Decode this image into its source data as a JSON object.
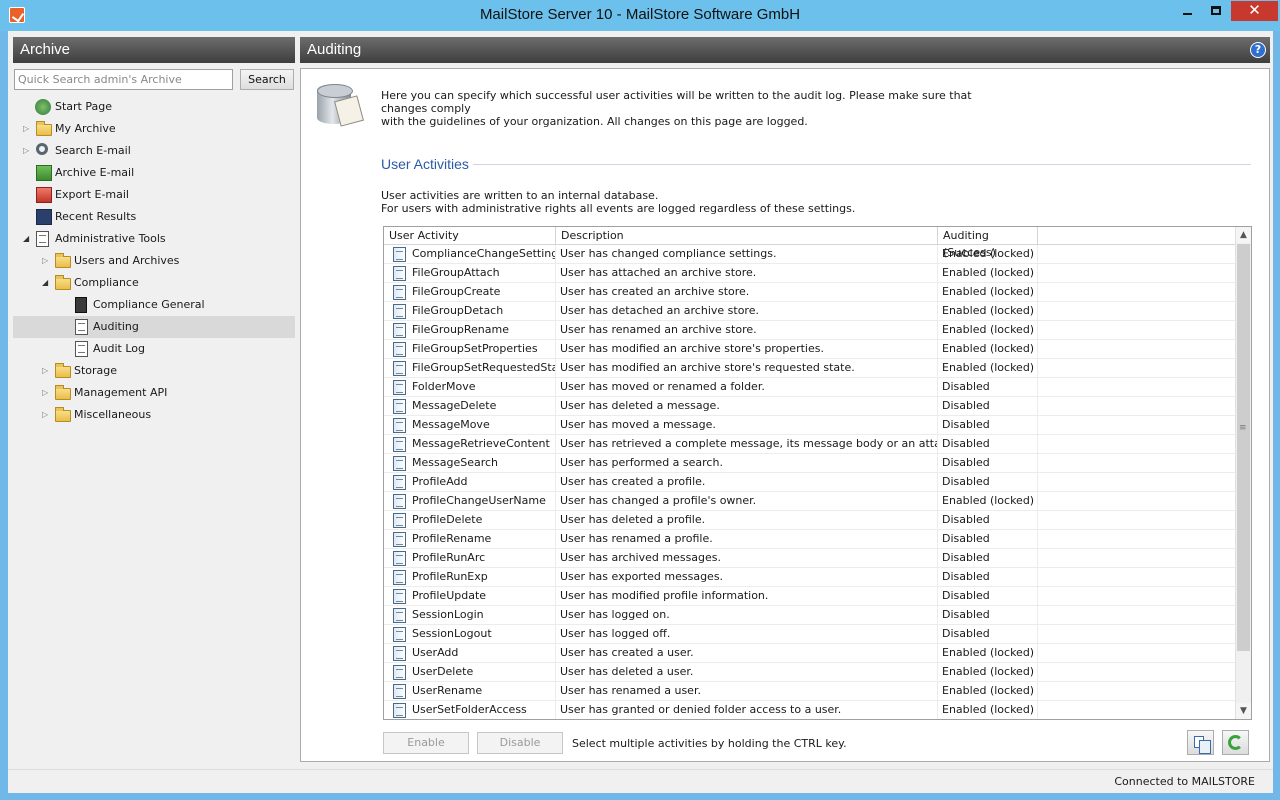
{
  "window": {
    "title": "MailStore Server 10 - MailStore Software GmbH",
    "minimize": "—",
    "close": "✕"
  },
  "sidebar": {
    "title": "Archive",
    "search_placeholder": "Quick Search admin's Archive",
    "search_button": "Search",
    "items": [
      {
        "label": "Start Page"
      },
      {
        "label": "My Archive"
      },
      {
        "label": "Search E-mail"
      },
      {
        "label": "Archive E-mail"
      },
      {
        "label": "Export E-mail"
      },
      {
        "label": "Recent Results"
      },
      {
        "label": "Administrative Tools"
      },
      {
        "label": "Users and Archives"
      },
      {
        "label": "Compliance"
      },
      {
        "label": "Compliance General"
      },
      {
        "label": "Auditing"
      },
      {
        "label": "Audit Log"
      },
      {
        "label": "Storage"
      },
      {
        "label": "Management API"
      },
      {
        "label": "Miscellaneous"
      }
    ]
  },
  "main": {
    "title": "Auditing",
    "help": "?",
    "intro_line1": "Here you can specify which successful user activities will be written to the audit log. Please make sure that changes comply",
    "intro_line2": "with the guidelines of your organization. All changes on this page are logged.",
    "section_title": "User Activities",
    "note_line1": "User activities are written to an internal database.",
    "note_line2": "For users with administrative rights all events are logged regardless of these settings.",
    "columns": [
      "User Activity",
      "Description",
      "Auditing (Success)"
    ],
    "rows": [
      {
        "activity": "ComplianceChangeSettings",
        "description": "User has changed compliance settings.",
        "auditing": "Enabled (locked)"
      },
      {
        "activity": "FileGroupAttach",
        "description": "User has attached an archive store.",
        "auditing": "Enabled (locked)"
      },
      {
        "activity": "FileGroupCreate",
        "description": "User has created an archive store.",
        "auditing": "Enabled (locked)"
      },
      {
        "activity": "FileGroupDetach",
        "description": "User has detached an archive store.",
        "auditing": "Enabled (locked)"
      },
      {
        "activity": "FileGroupRename",
        "description": "User has renamed an archive store.",
        "auditing": "Enabled (locked)"
      },
      {
        "activity": "FileGroupSetProperties",
        "description": "User has modified an archive store's properties.",
        "auditing": "Enabled (locked)"
      },
      {
        "activity": "FileGroupSetRequestedState",
        "description": "User has modified an archive store's requested state.",
        "auditing": "Enabled (locked)"
      },
      {
        "activity": "FolderMove",
        "description": "User has moved or renamed a folder.",
        "auditing": "Disabled"
      },
      {
        "activity": "MessageDelete",
        "description": "User has deleted a message.",
        "auditing": "Disabled"
      },
      {
        "activity": "MessageMove",
        "description": "User has moved a message.",
        "auditing": "Disabled"
      },
      {
        "activity": "MessageRetrieveContent",
        "description": "User has retrieved a complete message, its message body or an attachment.",
        "auditing": "Disabled"
      },
      {
        "activity": "MessageSearch",
        "description": "User has performed a search.",
        "auditing": "Disabled"
      },
      {
        "activity": "ProfileAdd",
        "description": "User has created a profile.",
        "auditing": "Disabled"
      },
      {
        "activity": "ProfileChangeUserName",
        "description": "User has changed a profile's owner.",
        "auditing": "Enabled (locked)"
      },
      {
        "activity": "ProfileDelete",
        "description": "User has deleted a profile.",
        "auditing": "Disabled"
      },
      {
        "activity": "ProfileRename",
        "description": "User has renamed a profile.",
        "auditing": "Disabled"
      },
      {
        "activity": "ProfileRunArc",
        "description": "User has archived messages.",
        "auditing": "Disabled"
      },
      {
        "activity": "ProfileRunExp",
        "description": "User has exported messages.",
        "auditing": "Disabled"
      },
      {
        "activity": "ProfileUpdate",
        "description": "User has modified profile information.",
        "auditing": "Disabled"
      },
      {
        "activity": "SessionLogin",
        "description": "User has logged on.",
        "auditing": "Disabled"
      },
      {
        "activity": "SessionLogout",
        "description": "User has logged off.",
        "auditing": "Disabled"
      },
      {
        "activity": "UserAdd",
        "description": "User has created a user.",
        "auditing": "Enabled (locked)"
      },
      {
        "activity": "UserDelete",
        "description": "User has deleted a user.",
        "auditing": "Enabled (locked)"
      },
      {
        "activity": "UserRename",
        "description": "User has renamed a user.",
        "auditing": "Enabled (locked)"
      },
      {
        "activity": "UserSetFolderAccess",
        "description": "User has granted or denied folder access to a user.",
        "auditing": "Enabled (locked)"
      }
    ],
    "enable_button": "Enable",
    "disable_button": "Disable",
    "hint": "Select multiple activities by holding the CTRL key."
  },
  "status": {
    "text": "Connected to MAILSTORE"
  }
}
